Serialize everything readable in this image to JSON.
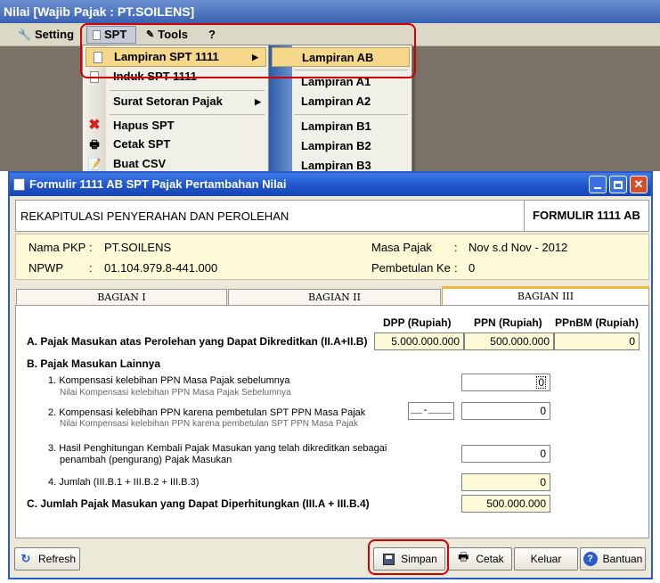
{
  "app": {
    "title": "Nilai [Wajib Pajak : PT.SOILENS]"
  },
  "menubar": {
    "setting": "Setting",
    "spt": "SPT",
    "tools": "Tools",
    "help": "?"
  },
  "spt_menu": {
    "items": [
      {
        "label": "Lampiran SPT 1111",
        "icon": "document-icon",
        "has_submenu": true,
        "highlighted": true
      },
      {
        "label": "Induk SPT 1111",
        "icon": "document-icon",
        "has_submenu": false
      },
      {
        "label": "Surat Setoran Pajak",
        "icon": "",
        "has_submenu": true
      },
      {
        "label": "Hapus SPT",
        "icon": "delete-x-icon"
      },
      {
        "label": "Cetak SPT",
        "icon": "printer-icon"
      },
      {
        "label": "Buat CSV",
        "icon": "csv-icon"
      }
    ]
  },
  "lampiran_submenu": {
    "items": [
      {
        "label": "Lampiran AB",
        "highlighted": true
      },
      {
        "label": "Lampiran A1"
      },
      {
        "label": "Lampiran A2"
      },
      {
        "label": "Lampiran B1"
      },
      {
        "label": "Lampiran B2"
      },
      {
        "label": "Lampiran B3"
      }
    ]
  },
  "dialog": {
    "title": "Formulir 1111 AB SPT Pajak Pertambahan Nilai",
    "header_left": "REKAPITULASI PENYERAHAN DAN PEROLEHAN",
    "header_right": "FORMULIR 1111 AB",
    "info": {
      "nama_pkp_label": "Nama PKP",
      "nama_pkp_value": "PT.SOILENS",
      "npwp_label": "NPWP",
      "npwp_value": "01.104.979.8-441.000",
      "masa_pajak_label": "Masa Pajak",
      "masa_pajak_value": "Nov s.d Nov - 2012",
      "pembetulan_label": "Pembetulan Ke",
      "pembetulan_value": "0",
      "colon": ":"
    },
    "tabs": [
      "BAGIAN I",
      "BAGIAN II",
      "BAGIAN III"
    ],
    "active_tab": 2,
    "columns": {
      "dpp": "DPP (Rupiah)",
      "ppn": "PPN (Rupiah)",
      "ppnbm": "PPnBM (Rupiah)"
    },
    "section_a": {
      "label": "A. Pajak Masukan atas Perolehan yang Dapat Dikreditkan (II.A+II.B)",
      "dpp": "5.000.000.000",
      "ppn": "500.000.000",
      "ppnbm": "0"
    },
    "section_b": {
      "label": "B. Pajak Masukan Lainnya",
      "item1_label": "1. Kompensasi kelebihan PPN Masa Pajak sebelumnya",
      "item1_sub": "Nilai Kompensasi kelebihan PPN Masa Pajak Sebelumnya",
      "item1_value": "0",
      "item2_label": "2. Kompensasi kelebihan PPN karena pembetulan SPT PPN Masa Pajak",
      "item2_sub": "Nilai Kompensasi kelebihan PPN karena pembetulan SPT PPN Masa Pajak",
      "item2_date": "__-____",
      "item2_value": "0",
      "item3_label_1": "3. Hasil Penghitungan Kembali Pajak Masukan yang telah dikreditkan sebagai",
      "item3_label_2": "penambah (pengurang) Pajak Masukan",
      "item3_value": "0",
      "item4_label": "4. Jumlah (III.B.1 + III.B.2 + III.B.3)",
      "item4_value": "0"
    },
    "section_c": {
      "label": "C. Jumlah Pajak Masukan yang Dapat Diperhitungkan (III.A + III.B.4)",
      "value": "500.000.000"
    },
    "buttons": {
      "refresh": "Refresh",
      "simpan": "Simpan",
      "cetak": "Cetak",
      "keluar": "Keluar",
      "bantuan": "Bantuan"
    }
  },
  "colors": {
    "highlight": "#f5d88a",
    "annotation_red": "#d40000",
    "title_blue": "#1d52c8",
    "field_yellow": "#fdfad8"
  }
}
